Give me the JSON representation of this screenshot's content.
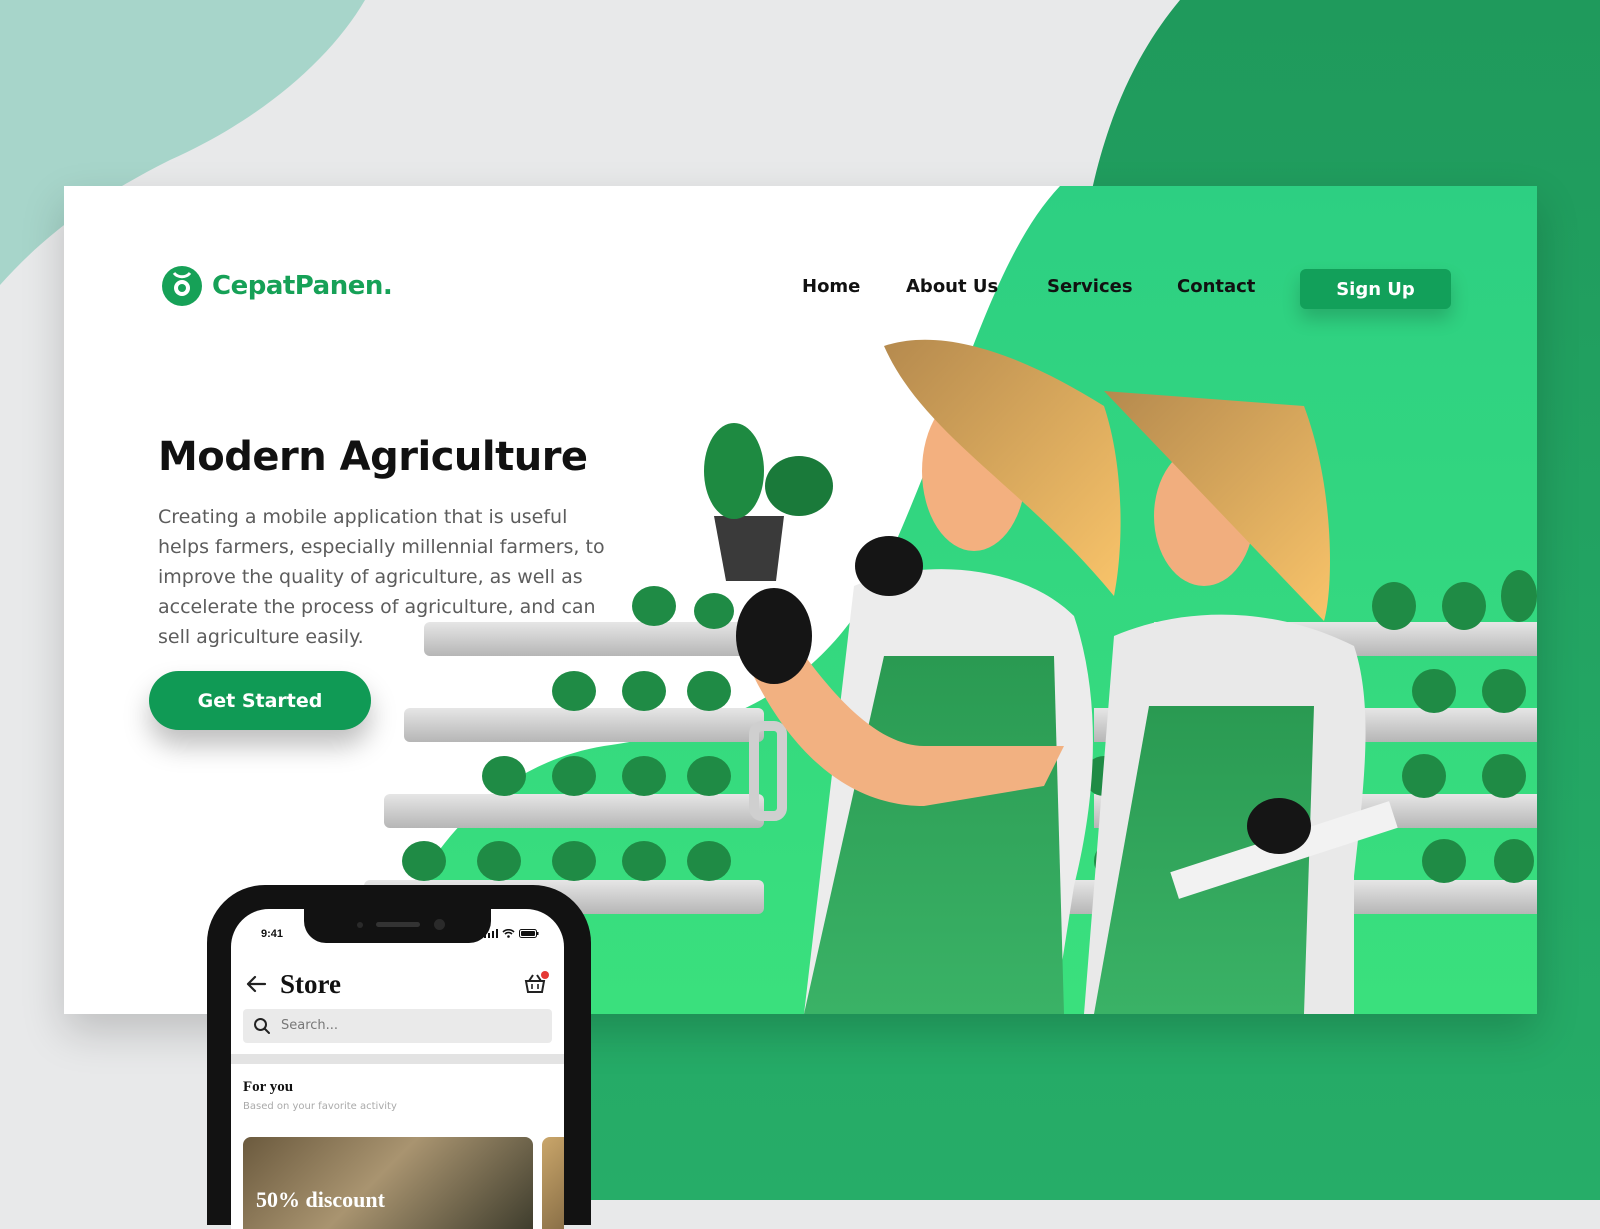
{
  "brand": {
    "name": "CepatPanen.",
    "color": "#16a157"
  },
  "nav": {
    "items": [
      "Home",
      "About Us",
      "Services",
      "Contact"
    ],
    "signup": "Sign Up"
  },
  "hero": {
    "title": "Modern Agriculture",
    "description": "Creating a mobile application that is useful helps farmers, especially millennial farmers, to improve the quality of agriculture, as well as accelerate the process of agriculture, and can sell agriculture easily.",
    "cta": "Get Started"
  },
  "phone": {
    "time": "9:41",
    "title": "Store",
    "search_placeholder": "Search...",
    "section_title": "For you",
    "section_subtitle": "Based on your favorite activity",
    "promo": "50% discount"
  },
  "colors": {
    "accent": "#12a05a",
    "light_green": "#35d57c",
    "bg_green": "#22a462",
    "teal": "#a7d5ca"
  },
  "icons": [
    "logo-icon",
    "back-arrow-icon",
    "basket-icon",
    "search-icon",
    "signal-icon",
    "wifi-icon",
    "battery-icon"
  ]
}
